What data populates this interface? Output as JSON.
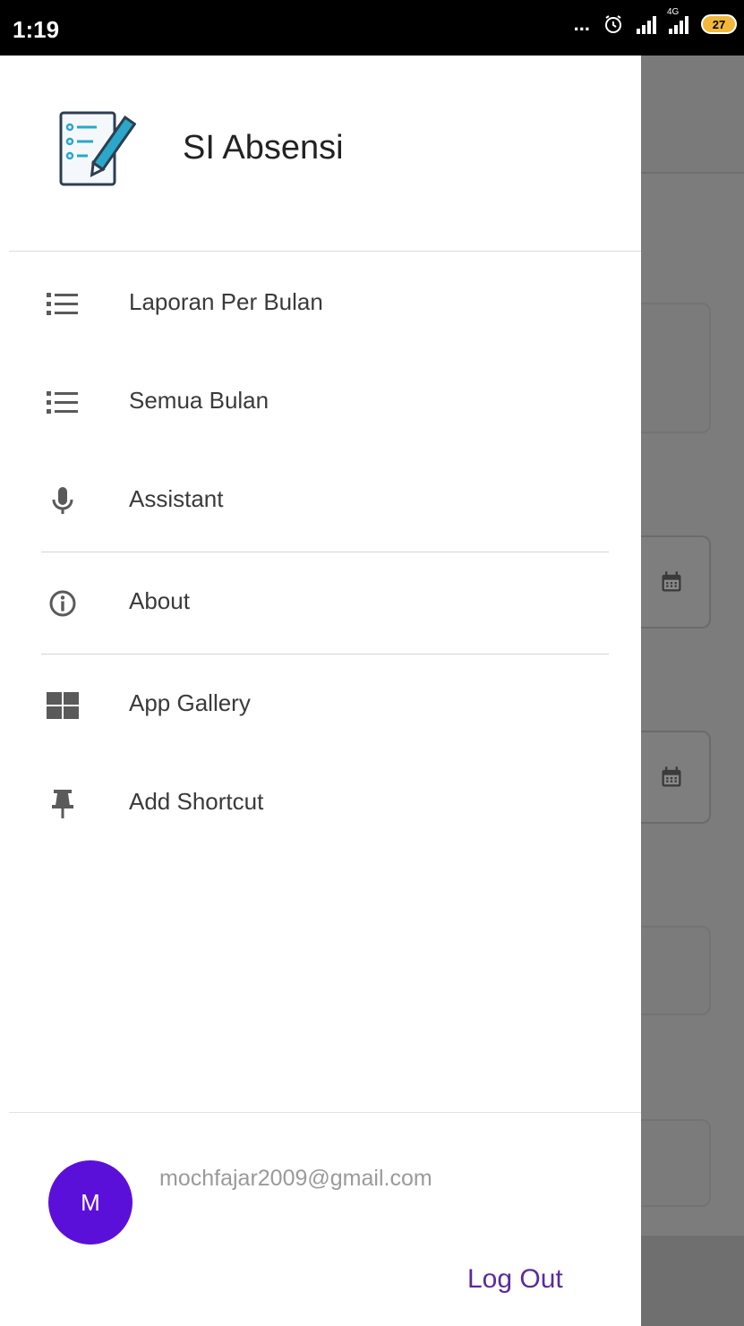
{
  "status_bar": {
    "time": "1:19",
    "more": "...",
    "network_badge": "4G",
    "battery": "27"
  },
  "drawer": {
    "app_title": "SI Absensi",
    "items": [
      {
        "label": "Laporan Per Bulan",
        "icon": "list-icon"
      },
      {
        "label": "Semua Bulan",
        "icon": "list-icon"
      },
      {
        "label": "Assistant",
        "icon": "microphone-icon"
      },
      {
        "label": "About",
        "icon": "info-icon"
      },
      {
        "label": "App Gallery",
        "icon": "grid-icon"
      },
      {
        "label": "Add Shortcut",
        "icon": "pin-icon"
      }
    ],
    "user": {
      "avatar_initial": "M",
      "email": "mochfajar2009@gmail.com"
    },
    "logout_label": "Log Out"
  },
  "colors": {
    "accent": "#5b10d9",
    "logout": "#5b2a9e",
    "icon": "#5a5a5a",
    "scrim": "#7a7a7a"
  }
}
